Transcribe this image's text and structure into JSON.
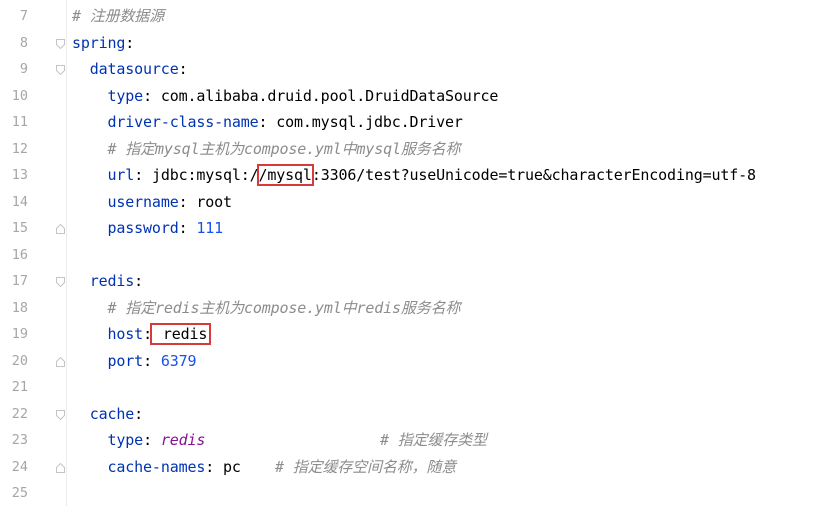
{
  "editor": {
    "lines": [
      {
        "num": "7",
        "indent": "",
        "comment": "# 注册数据源"
      },
      {
        "num": "8",
        "indent": "",
        "key": "spring",
        "sep": ":"
      },
      {
        "num": "9",
        "indent": "  ",
        "key": "datasource",
        "sep": ":"
      },
      {
        "num": "10",
        "indent": "    ",
        "key": "type",
        "sep": ": ",
        "value": "com.alibaba.druid.pool.DruidDataSource"
      },
      {
        "num": "11",
        "indent": "    ",
        "key": "driver-class-name",
        "sep": ": ",
        "value": "com.mysql.jdbc.Driver"
      },
      {
        "num": "12",
        "indent": "    ",
        "comment": "# 指定mysql主机为compose.yml中mysql服务名称"
      },
      {
        "num": "13",
        "indent": "    ",
        "key": "url",
        "sep": ": ",
        "value_pre": "jdbc:mysql:/",
        "value_hl": "/mysql",
        "value_post": ":3306/test?useUnicode=true&characterEncoding=utf-8"
      },
      {
        "num": "14",
        "indent": "    ",
        "key": "username",
        "sep": ": ",
        "value": "root"
      },
      {
        "num": "15",
        "indent": "    ",
        "key": "password",
        "sep": ": ",
        "value_num": "111"
      },
      {
        "num": "16",
        "indent": ""
      },
      {
        "num": "17",
        "indent": "  ",
        "key": "redis",
        "sep": ":"
      },
      {
        "num": "18",
        "indent": "    ",
        "comment": "# 指定redis主机为compose.yml中redis服务名称"
      },
      {
        "num": "19",
        "indent": "    ",
        "key": "host",
        "sep": ":",
        "value_hl": " redis"
      },
      {
        "num": "20",
        "indent": "    ",
        "key": "port",
        "sep": ": ",
        "value_num": "6379"
      },
      {
        "num": "21",
        "indent": ""
      },
      {
        "num": "22",
        "indent": "  ",
        "key": "cache",
        "sep": ":"
      },
      {
        "num": "23",
        "indent": "    ",
        "key": "type",
        "sep": ": ",
        "value_kw": "redis",
        "trail_comment": "# 指定缓存类型"
      },
      {
        "num": "24",
        "indent": "    ",
        "key": "cache-names",
        "sep": ": ",
        "value": "pc",
        "trail_comment": "# 指定缓存空间名称，随意"
      },
      {
        "num": "25",
        "indent": ""
      }
    ]
  },
  "colors": {
    "key": "#0033b3",
    "number": "#1750eb",
    "keyword_italic": "#871094",
    "comment": "#8c8c8c",
    "highlight_box": "#d83a3a",
    "line_number": "#a6a6a6"
  }
}
